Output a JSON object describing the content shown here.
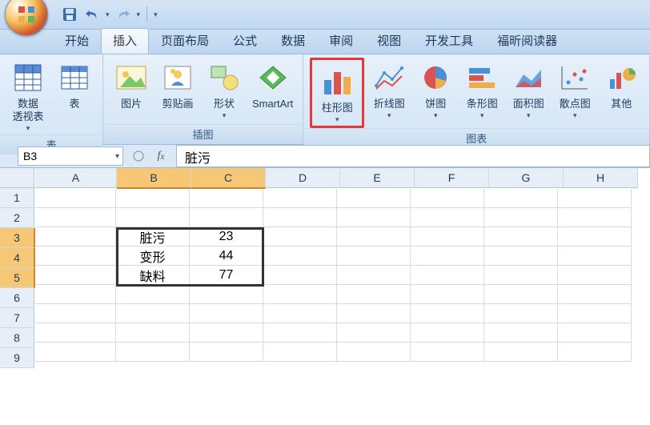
{
  "qat": {
    "save": "save",
    "undo": "undo",
    "redo": "redo"
  },
  "tabs": {
    "home": "开始",
    "insert": "插入",
    "page_layout": "页面布局",
    "formulas": "公式",
    "data": "数据",
    "review": "审阅",
    "view": "视图",
    "developer": "开发工具",
    "foxit": "福昕阅读器"
  },
  "ribbon": {
    "groups": {
      "tables": "表",
      "illustrations": "插图",
      "charts": "图表"
    },
    "pivot": "数据\n透视表",
    "table": "表",
    "picture": "图片",
    "clipart": "剪贴画",
    "shapes": "形状",
    "smartart": "SmartArt",
    "column": "柱形图",
    "line": "折线图",
    "pie": "饼图",
    "bar": "条形图",
    "area": "面积图",
    "scatter": "散点图",
    "other": "其他"
  },
  "name_box": "B3",
  "formula": "脏污",
  "columns": [
    "A",
    "B",
    "C",
    "D",
    "E",
    "F",
    "G",
    "H"
  ],
  "rows": [
    "1",
    "2",
    "3",
    "4",
    "5",
    "6",
    "7",
    "8",
    "9"
  ],
  "cells": {
    "B3": "脏污",
    "C3": "23",
    "B4": "变形",
    "C4": "44",
    "B5": "缺料",
    "C5": "77"
  }
}
